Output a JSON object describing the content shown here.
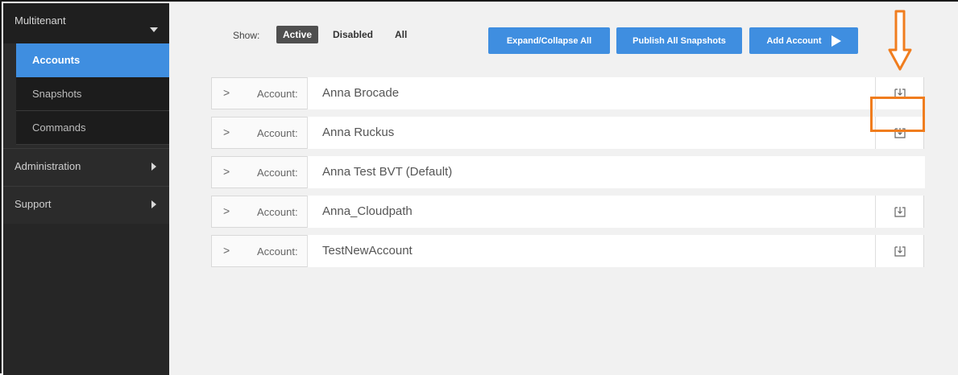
{
  "sidebar": {
    "group": "Multitenant",
    "subitems": [
      {
        "label": "Accounts",
        "active": true
      },
      {
        "label": "Snapshots",
        "active": false
      },
      {
        "label": "Commands",
        "active": false
      }
    ],
    "sections": [
      "Administration",
      "Support"
    ]
  },
  "toolbar": {
    "show_label": "Show:",
    "filters": [
      {
        "label": "Active",
        "active": true
      },
      {
        "label": "Disabled",
        "active": false
      },
      {
        "label": "All",
        "active": false
      }
    ],
    "expand_collapse_label": "Expand/Collapse All",
    "publish_label": "Publish All Snapshots",
    "add_account_label": "Add Account"
  },
  "accounts": {
    "field_label": "Account:",
    "rows": [
      {
        "name": "Anna Brocade",
        "has_download": true,
        "highlighted": true
      },
      {
        "name": "Anna Ruckus",
        "has_download": true,
        "highlighted": false
      },
      {
        "name": "Anna Test BVT (Default)",
        "has_download": false,
        "highlighted": false
      },
      {
        "name": "Anna_Cloudpath",
        "has_download": true,
        "highlighted": false
      },
      {
        "name": "TestNewAccount",
        "has_download": true,
        "highlighted": false
      }
    ]
  },
  "colors": {
    "accent_blue": "#3f8ee0",
    "callout_orange": "#f07d1e",
    "sidebar_dark": "#2b2b2b"
  },
  "icons": {
    "download": "download-snapshot-icon",
    "callout": "down-arrow-callout-icon"
  }
}
